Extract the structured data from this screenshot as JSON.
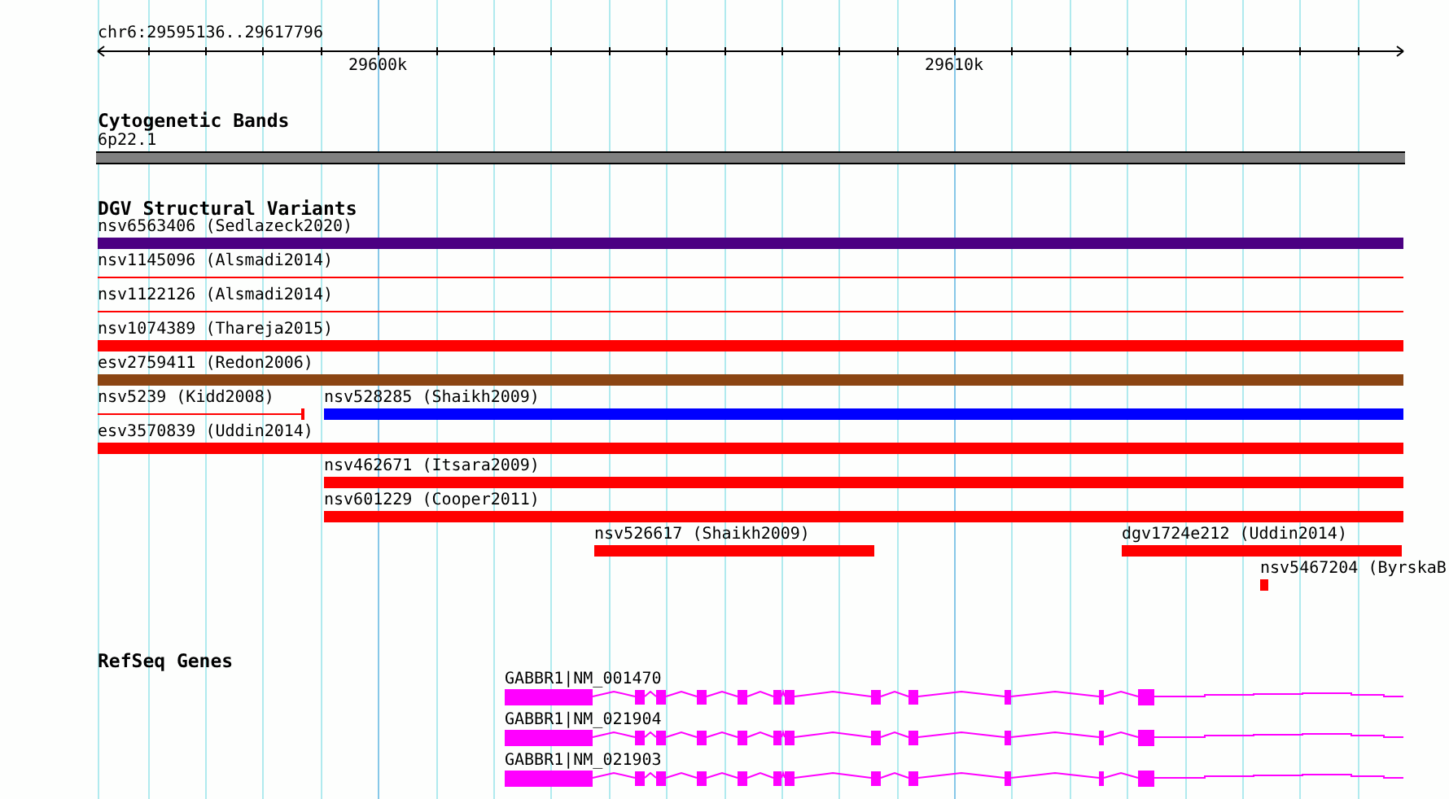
{
  "ruler": {
    "location": "chr6:29595136..29617796",
    "ticks": [
      "29600k",
      "29610k"
    ]
  },
  "tracks": [
    {
      "kind": "bands",
      "title": "Cytogenetic Bands",
      "features": [
        {
          "label": "6p22.1"
        }
      ]
    },
    {
      "kind": "variants",
      "title": "DGV Structural Variants",
      "features": [
        {
          "label": "nsv6563406 (Sedlazeck2020)",
          "kind": "bar",
          "color": "#4b0082"
        },
        {
          "label": "nsv1145096 (Alsmadi2014)",
          "kind": "line",
          "color": "#ff0000"
        },
        {
          "label": "nsv1122126 (Alsmadi2014)",
          "kind": "line",
          "color": "#ff0000"
        },
        {
          "label": "nsv1074389 (Thareja2015)",
          "kind": "bar",
          "color": "#ff0000"
        },
        {
          "label": "esv2759411 (Redon2006)",
          "kind": "bar",
          "color": "#8b4513"
        },
        {
          "label": "nsv5239 (Kidd2008)",
          "kind": "line",
          "color": "#ff0000"
        },
        {
          "label": "nsv528285 (Shaikh2009)",
          "kind": "bar",
          "color": "#0000ff"
        },
        {
          "label": "esv3570839 (Uddin2014)",
          "kind": "bar",
          "color": "#ff0000"
        },
        {
          "label": "nsv462671 (Itsara2009)",
          "kind": "bar",
          "color": "#ff0000"
        },
        {
          "label": "nsv601229 (Cooper2011)",
          "kind": "bar",
          "color": "#ff0000"
        },
        {
          "label": "nsv526617 (Shaikh2009)",
          "kind": "bar",
          "color": "#ff0000"
        },
        {
          "label": "dgv1724e212 (Uddin2014)",
          "kind": "bar",
          "color": "#ff0000"
        },
        {
          "label": "nsv5467204 (ByrskaB",
          "kind": "bar",
          "color": "#ff0000"
        }
      ]
    },
    {
      "kind": "genes",
      "title": "RefSeq Genes",
      "features": [
        {
          "label": "GABBR1|NM_001470"
        },
        {
          "label": "GABBR1|NM_021904"
        },
        {
          "label": "GABBR1|NM_021903"
        }
      ]
    }
  ]
}
